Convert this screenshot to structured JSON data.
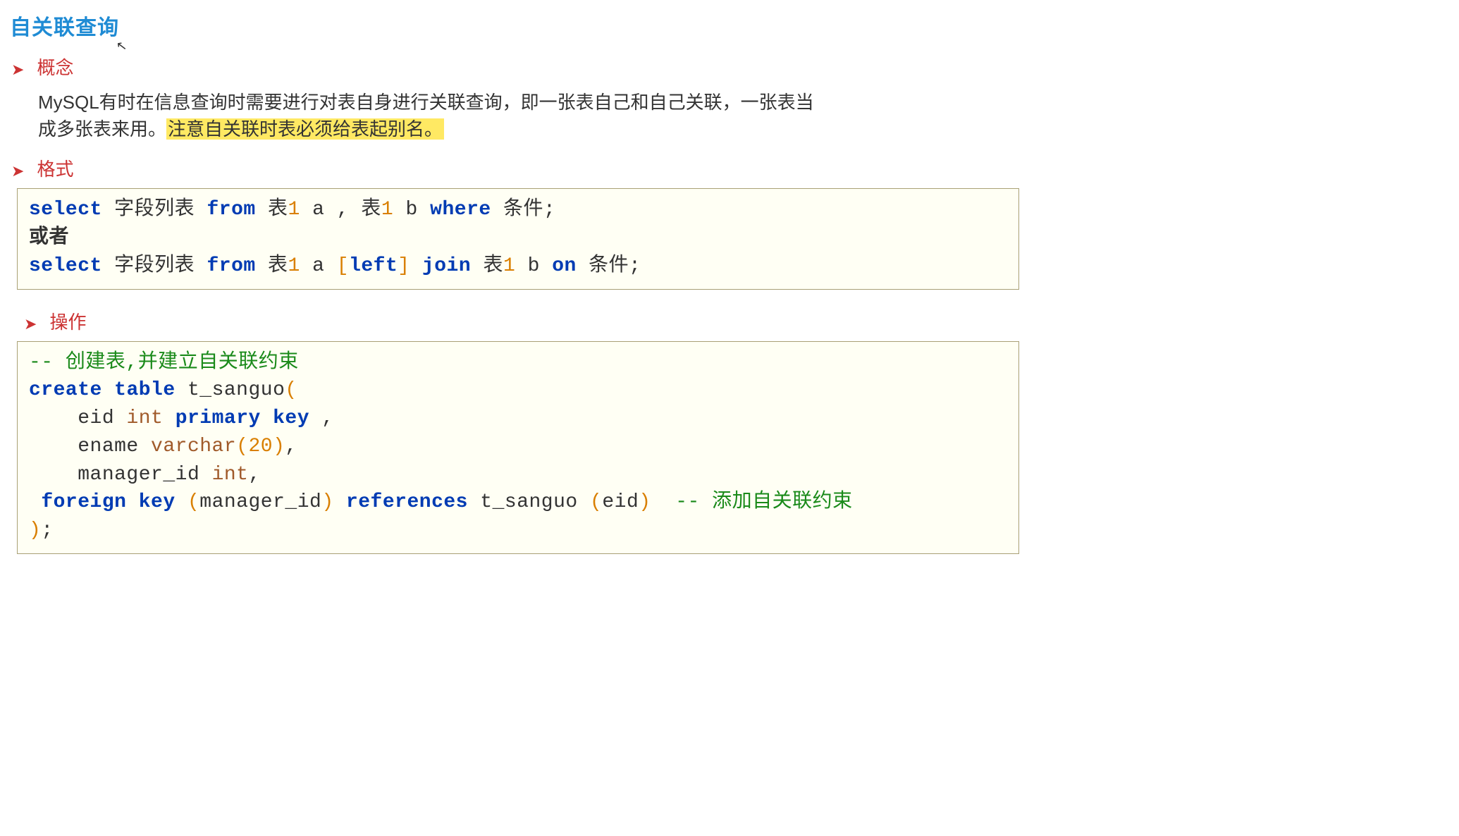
{
  "cursor_glyph": "↖",
  "title": "自关联查询",
  "sections": {
    "concept_label": "概念",
    "format_label": "格式",
    "operation_label": "操作"
  },
  "concept_text": {
    "plain_pre": "MySQL有时在信息查询时需要进行对表自身进行关联查询，即一张表自己和自己关联，一张表当成多张表来用。",
    "highlight": "注意自关联时表必须给表起别名。"
  },
  "format_code": {
    "line1": {
      "kw_select": "select",
      "fieldlist": "字段列表",
      "kw_from": "from",
      "table_a": "表",
      "num1_a": "1",
      "alias_a": "a",
      "comma": ",",
      "table_b": "表",
      "num1_b": "1",
      "alias_b": "b",
      "kw_where": "where",
      "cond": "条件;"
    },
    "or_label": "或者",
    "line2": {
      "kw_select": "select",
      "fieldlist": "字段列表",
      "kw_from": "from",
      "table_a": "表",
      "num1_a": "1",
      "alias_a": "a",
      "lbr": "[",
      "kw_left": "left",
      "rbr": "]",
      "kw_join": "join",
      "table_b": "表",
      "num1_b": "1",
      "alias_b": "b",
      "kw_on": "on",
      "cond": "条件;"
    }
  },
  "op_code": {
    "comment_top": "-- 创建表,并建立自关联约束",
    "create": "create",
    "table_kw": "table",
    "table_name": "t_sanguo",
    "lpar": "(",
    "eid": "eid",
    "int": "int",
    "primary": "primary",
    "key": "key",
    "comma1": ",",
    "ename": "ename",
    "varchar": "varchar",
    "lpar2": "(",
    "varlen": "20",
    "rpar2": ")",
    "comma2": ",",
    "manager_id": "manager_id",
    "int2": "int",
    "comma3": ",",
    "foreign": "foreign",
    "key2": "key",
    "lpar3": "(",
    "fk_col": "manager_id",
    "rpar3": ")",
    "references": "references",
    "ref_table": "t_sanguo",
    "lpar4": "(",
    "ref_col": "eid",
    "rpar4": ")",
    "comment_end": "-- 添加自关联约束",
    "rpar_outer": ")",
    "semi": ";"
  }
}
